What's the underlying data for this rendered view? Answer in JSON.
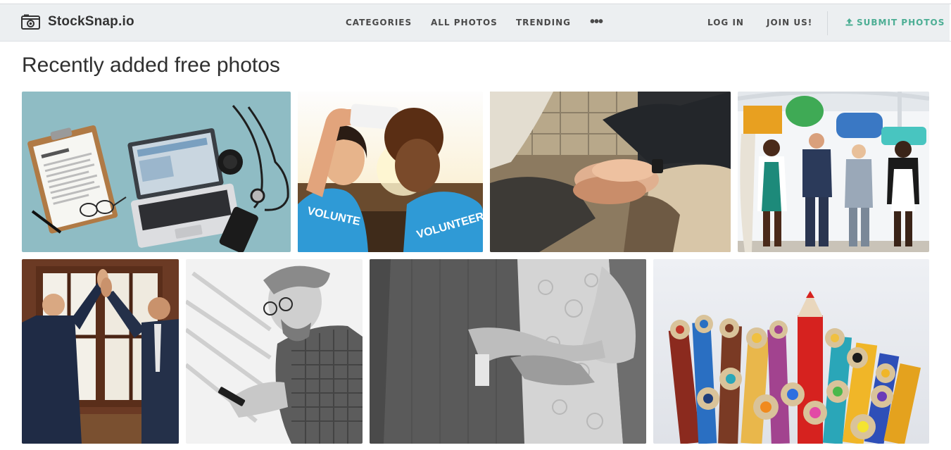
{
  "brand": {
    "name": "StockSnap.io",
    "icon": "camera-icon"
  },
  "nav": {
    "categories": "CATEGORIES",
    "all_photos": "ALL PHOTOS",
    "trending": "TRENDING",
    "more": "•••",
    "login": "LOG IN",
    "join": "JOIN US!",
    "submit": "SUBMIT PHOTOS",
    "submit_icon": "upload-icon"
  },
  "colors": {
    "navbar_bg": "#eceff1",
    "accent": "#4cae94",
    "nav_text": "#4a4a4a"
  },
  "main": {
    "title": "Recently added free photos",
    "photos": [
      {
        "name": "photo-laptop-contract",
        "subject": "laptop, contract clipboard, stethoscope and glasses on teal desk"
      },
      {
        "name": "photo-volunteers-selfie",
        "subject": "two volunteers taking a selfie"
      },
      {
        "name": "photo-team-hands",
        "subject": "team stacking hands together"
      },
      {
        "name": "photo-speech-bubbles",
        "subject": "four people holding speech bubbles"
      },
      {
        "name": "photo-high-five",
        "subject": "two businessmen giving a high five"
      },
      {
        "name": "photo-man-phone",
        "subject": "man looking at phone, black and white"
      },
      {
        "name": "photo-couple-embrace",
        "subject": "couple embracing, black and white"
      },
      {
        "name": "photo-colored-pencils",
        "subject": "colored pencils close-up"
      }
    ]
  }
}
